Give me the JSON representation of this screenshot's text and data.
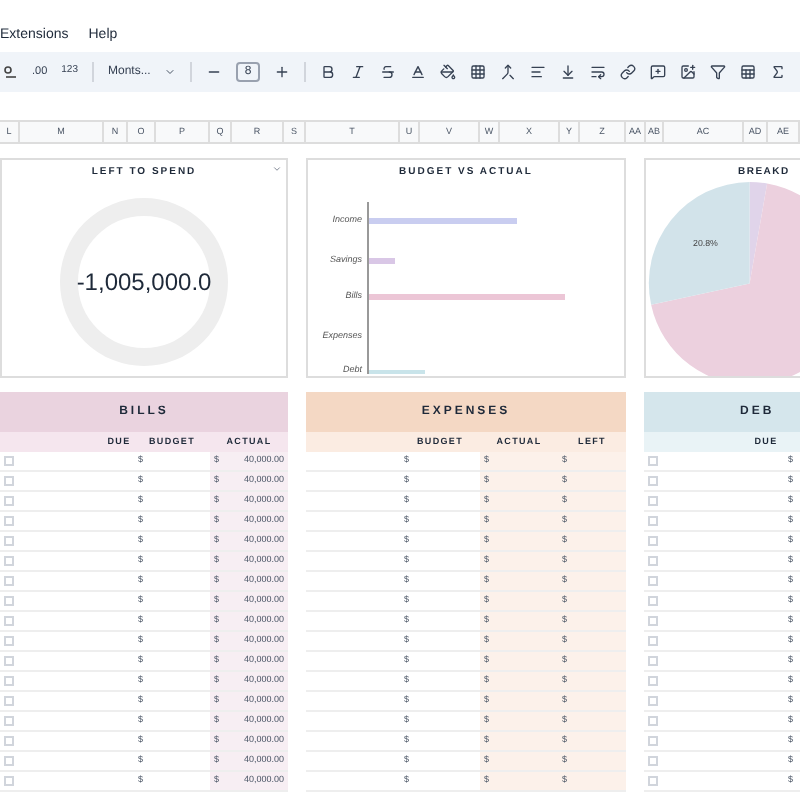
{
  "menu": [
    {
      "label": "Extensions"
    },
    {
      "label": "Help"
    }
  ],
  "toolbar": {
    "decimal": ".00",
    "format": "123",
    "font": "Monts...",
    "font_size": "8"
  },
  "columns": [
    "L",
    "M",
    "N",
    "O",
    "P",
    "Q",
    "R",
    "S",
    "T",
    "U",
    "V",
    "W",
    "X",
    "Y",
    "Z",
    "AA",
    "AB",
    "AC",
    "AD",
    "AE"
  ],
  "left_to_spend": {
    "title": "LEFT TO SPEND",
    "value": "-1,005,000.0"
  },
  "budget_chart": {
    "title": "BUDGET VS ACTUAL",
    "categories": [
      "Income",
      "Savings",
      "Bills",
      "Expenses",
      "Debt"
    ]
  },
  "breakdown": {
    "title": "BREAKD",
    "slice_label": "20.8%"
  },
  "bills": {
    "title": "BILLS",
    "columns": [
      "DUE",
      "BUDGET",
      "ACTUAL"
    ],
    "rows": [
      {
        "checked": false,
        "budget": "$",
        "actual_currency": "$",
        "actual": "40,000.00"
      },
      {
        "checked": false,
        "budget": "$",
        "actual_currency": "$",
        "actual": "40,000.00"
      },
      {
        "checked": false,
        "budget": "$",
        "actual_currency": "$",
        "actual": "40,000.00"
      },
      {
        "checked": false,
        "budget": "$",
        "actual_currency": "$",
        "actual": "40,000.00"
      },
      {
        "checked": false,
        "budget": "$",
        "actual_currency": "$",
        "actual": "40,000.00"
      },
      {
        "checked": false,
        "budget": "$",
        "actual_currency": "$",
        "actual": "40,000.00"
      },
      {
        "checked": false,
        "budget": "$",
        "actual_currency": "$",
        "actual": "40,000.00"
      },
      {
        "checked": false,
        "budget": "$",
        "actual_currency": "$",
        "actual": "40,000.00"
      },
      {
        "checked": false,
        "budget": "$",
        "actual_currency": "$",
        "actual": "40,000.00"
      },
      {
        "checked": false,
        "budget": "$",
        "actual_currency": "$",
        "actual": "40,000.00"
      },
      {
        "checked": false,
        "budget": "$",
        "actual_currency": "$",
        "actual": "40,000.00"
      },
      {
        "checked": false,
        "budget": "$",
        "actual_currency": "$",
        "actual": "40,000.00"
      },
      {
        "checked": false,
        "budget": "$",
        "actual_currency": "$",
        "actual": "40,000.00"
      },
      {
        "checked": false,
        "budget": "$",
        "actual_currency": "$",
        "actual": "40,000.00"
      },
      {
        "checked": false,
        "budget": "$",
        "actual_currency": "$",
        "actual": "40,000.00"
      },
      {
        "checked": false,
        "budget": "$",
        "actual_currency": "$",
        "actual": "40,000.00"
      },
      {
        "checked": false,
        "budget": "$",
        "actual_currency": "$",
        "actual": "40,000.00"
      }
    ]
  },
  "expenses": {
    "title": "EXPENSES",
    "columns": [
      "BUDGET",
      "ACTUAL",
      "LEFT"
    ],
    "rows": [
      {
        "budget": "$",
        "actual": "$",
        "left": "$"
      },
      {
        "budget": "$",
        "actual": "$",
        "left": "$"
      },
      {
        "budget": "$",
        "actual": "$",
        "left": "$"
      },
      {
        "budget": "$",
        "actual": "$",
        "left": "$"
      },
      {
        "budget": "$",
        "actual": "$",
        "left": "$"
      },
      {
        "budget": "$",
        "actual": "$",
        "left": "$"
      },
      {
        "budget": "$",
        "actual": "$",
        "left": "$"
      },
      {
        "budget": "$",
        "actual": "$",
        "left": "$"
      },
      {
        "budget": "$",
        "actual": "$",
        "left": "$"
      },
      {
        "budget": "$",
        "actual": "$",
        "left": "$"
      },
      {
        "budget": "$",
        "actual": "$",
        "left": "$"
      },
      {
        "budget": "$",
        "actual": "$",
        "left": "$"
      },
      {
        "budget": "$",
        "actual": "$",
        "left": "$"
      },
      {
        "budget": "$",
        "actual": "$",
        "left": "$"
      },
      {
        "budget": "$",
        "actual": "$",
        "left": "$"
      },
      {
        "budget": "$",
        "actual": "$",
        "left": "$"
      },
      {
        "budget": "$",
        "actual": "$",
        "left": "$"
      }
    ]
  },
  "debt": {
    "title": "DEB",
    "columns": [
      "DUE"
    ],
    "rows": [
      {
        "checked": false,
        "budget": "$"
      },
      {
        "checked": false,
        "budget": "$"
      },
      {
        "checked": false,
        "budget": "$"
      },
      {
        "checked": false,
        "budget": "$"
      },
      {
        "checked": false,
        "budget": "$"
      },
      {
        "checked": false,
        "budget": "$"
      },
      {
        "checked": false,
        "budget": "$"
      },
      {
        "checked": false,
        "budget": "$"
      },
      {
        "checked": false,
        "budget": "$"
      },
      {
        "checked": false,
        "budget": "$"
      },
      {
        "checked": false,
        "budget": "$"
      },
      {
        "checked": false,
        "budget": "$"
      },
      {
        "checked": false,
        "budget": "$"
      },
      {
        "checked": false,
        "budget": "$"
      },
      {
        "checked": false,
        "budget": "$"
      },
      {
        "checked": false,
        "budget": "$"
      },
      {
        "checked": false,
        "budget": "$"
      }
    ]
  }
}
